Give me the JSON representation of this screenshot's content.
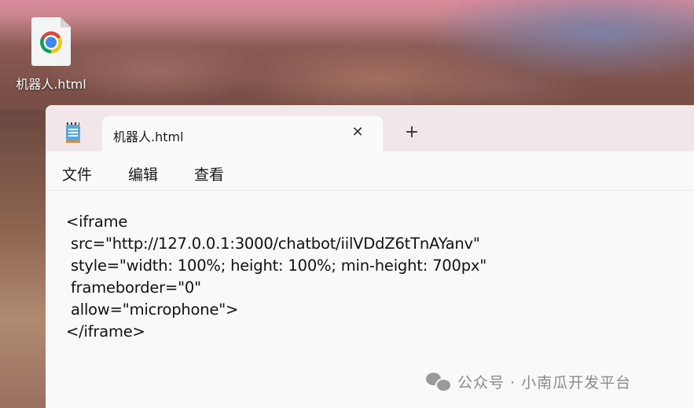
{
  "desktop": {
    "icon_label": "机器人.html"
  },
  "window": {
    "tab_title": "机器人.html",
    "close_glyph": "✕",
    "new_tab_glyph": "+",
    "menu": [
      "文件",
      "编辑",
      "查看"
    ],
    "content_lines": [
      "<iframe",
      " src=\"http://127.0.0.1:3000/chatbot/iilVDdZ6tTnAYanv\"",
      " style=\"width: 100%; height: 100%; min-height: 700px\"",
      " frameborder=\"0\"",
      " allow=\"microphone\">",
      "</iframe>"
    ]
  },
  "watermark": {
    "text": "公众号 · 小南瓜开发平台"
  }
}
